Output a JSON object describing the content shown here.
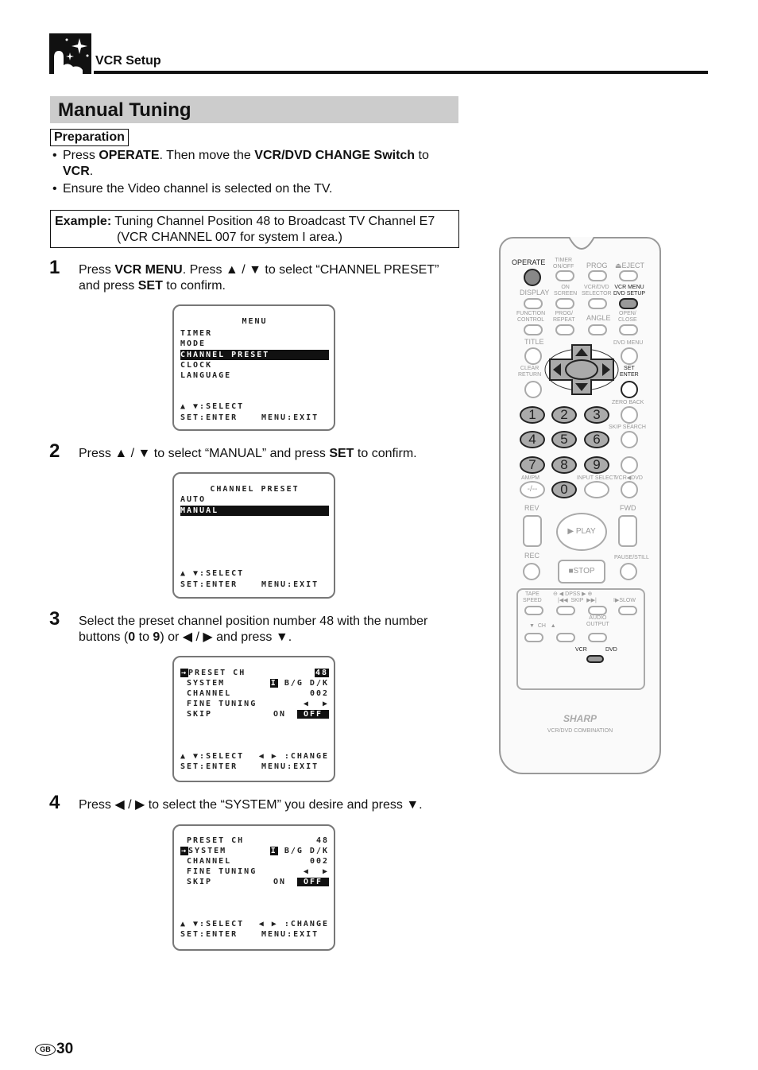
{
  "header": {
    "section": "VCR Setup",
    "logo_icon": "sparkle-hand-icon"
  },
  "title": "Manual Tuning",
  "preparation": {
    "label": "Preparation",
    "bullets": [
      {
        "pre": "Press ",
        "b1": "OPERATE",
        "mid": ". Then move the ",
        "b2": "VCR/DVD CHANGE Switch",
        "post": " to ",
        "b3": "VCR",
        "end": "."
      },
      {
        "text": "Ensure the Video channel is selected on the TV."
      }
    ]
  },
  "example": {
    "label": "Example:",
    "line1": " Tuning Channel Position 48 to Broadcast TV Channel E7",
    "line2": "(VCR CHANNEL 007 for system I area.)"
  },
  "steps": [
    {
      "num": "1",
      "parts": [
        "Press ",
        "VCR MENU",
        ". Press ▲ / ▼ to select “CHANNEL PRESET” and press ",
        "SET",
        " to confirm."
      ]
    },
    {
      "num": "2",
      "parts": [
        "Press ▲ / ▼ to select “MANUAL” and press ",
        "SET",
        " to confirm."
      ]
    },
    {
      "num": "3",
      "parts": [
        "Select the preset channel position number 48 with the number buttons (",
        "0",
        " to ",
        "9",
        ") or ◀ / ▶ and press ▼."
      ]
    },
    {
      "num": "4",
      "parts": [
        "Press ◀ / ▶  to select the “SYSTEM” you desire and press ▼."
      ]
    }
  ],
  "screens": {
    "menu": {
      "title": "MENU",
      "items": [
        "TIMER",
        "MODE",
        "CHANNEL PRESET",
        "CLOCK",
        "LANGUAGE"
      ],
      "selected": "CHANNEL PRESET",
      "footer1": "▲ ▼:SELECT",
      "footer2a": "SET:ENTER",
      "footer2b": "MENU:EXIT"
    },
    "channel_preset": {
      "title": "CHANNEL PRESET",
      "items": [
        "AUTO",
        "MANUAL"
      ],
      "selected": "MANUAL",
      "footer1": "▲ ▼:SELECT",
      "footer2a": "SET:ENTER",
      "footer2b": "MENU:EXIT"
    },
    "manual_step3": {
      "cursor": "PRESET CH",
      "rows": [
        {
          "label": "PRESET CH",
          "value": "48"
        },
        {
          "label": "SYSTEM",
          "opt_sel": "I",
          "opts": "B/G D/K"
        },
        {
          "label": "CHANNEL",
          "value": "002"
        },
        {
          "label": "FINE TUNING",
          "value": "◀  ▶"
        },
        {
          "label": "SKIP",
          "on": "ON",
          "off": "OFF"
        }
      ],
      "footer1a": "▲ ▼:SELECT",
      "footer1b": "◀ ▶ :CHANGE",
      "footer2a": "SET:ENTER",
      "footer2b": "MENU:EXIT"
    },
    "manual_step4": {
      "cursor": "SYSTEM",
      "rows": [
        {
          "label": "PRESET CH",
          "value": "48"
        },
        {
          "label": "SYSTEM",
          "opt_sel": "I",
          "opts": "B/G D/K"
        },
        {
          "label": "CHANNEL",
          "value": "002"
        },
        {
          "label": "FINE TUNING",
          "value": "◀  ▶"
        },
        {
          "label": "SKIP",
          "on": "ON",
          "off": "OFF"
        }
      ],
      "footer1a": "▲ ▼:SELECT",
      "footer1b": "◀ ▶ :CHANGE",
      "footer2a": "SET:ENTER",
      "footer2b": "MENU:EXIT"
    }
  },
  "remote": {
    "labels": {
      "operate": "OPERATE",
      "timer": "TIMER\nON/OFF",
      "prog": "PROG",
      "eject": "⏏EJECT",
      "display": "DISPLAY",
      "on_screen": "ON\nSCREEN",
      "selector": "VCR/DVD\nSELECTOR",
      "vcr_menu": "VCR MENU\nDVD SETUP",
      "function": "FUNCTION\nCONTROL",
      "prog_repeat": "PROG/\nREPEAT",
      "angle": "ANGLE",
      "open_close": "OPEN/\nCLOSE",
      "title": "TITLE",
      "dvd_menu": "DVD MENU",
      "clear": "CLEAR\nRETURN",
      "set": "SET\nENTER",
      "zero_back": "ZERO BACK",
      "skip_search": "SKIP SEARCH",
      "am_pm": "AM/PM",
      "input_select": "INPUT SELECT",
      "vcr_dvd": "VCR◀DVD",
      "rev": "REV",
      "fwd": "FWD",
      "play": "▶ PLAY",
      "rec": "REC",
      "stop": "■STOP",
      "pause": "PAUSE/STILL",
      "tape_speed": "TAPE\nSPEED",
      "dpss": "⊖ ◀ DPSS ▶ ⊕",
      "skip": "|◀◀  SKIP  ▶▶|",
      "slow": "I▶SLOW",
      "ch": "▼  CH   ▲",
      "audio_output": "AUDIO\nOUTPUT",
      "vcr": "VCR",
      "dvd": "DVD",
      "brand": "SHARP",
      "model": "VCR/DVD COMBINATION",
      "dash": "-/--"
    },
    "numbers": [
      "1",
      "2",
      "3",
      "4",
      "5",
      "6",
      "7",
      "8",
      "9",
      "0"
    ]
  },
  "footer": {
    "region": "GB",
    "page": "30"
  }
}
